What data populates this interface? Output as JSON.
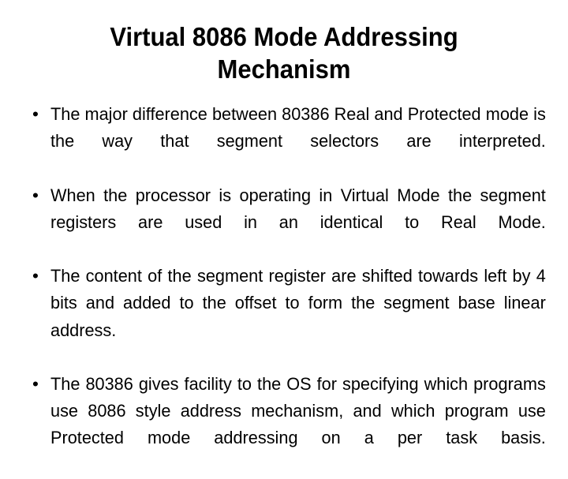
{
  "slide": {
    "title": "Virtual 8086 Mode Addressing\nMechanism",
    "title_lines": [
      "Virtual 8086 Mode Addressing",
      "Mechanism"
    ],
    "background_color": "#ffffff",
    "text_color": "#000000",
    "bullet_glyph": "•",
    "bullets": [
      {
        "marker": "•",
        "text": "The major difference between 80386 Real and Protected mode is the way that segment selectors are interpreted."
      },
      {
        "marker": "•",
        "text": "When the processor is operating in Virtual Mode the segment registers are used in an identical to Real Mode."
      },
      {
        "marker": "•",
        "text": "The content of the segment register are shifted towards left by 4 bits and added to the offset to form the segment base linear address."
      },
      {
        "marker": "•",
        "text": "The 80386 gives facility to the OS for specifying which programs use 8086 style address mechanism, and which program use Protected mode addressing on a per task basis."
      }
    ]
  }
}
